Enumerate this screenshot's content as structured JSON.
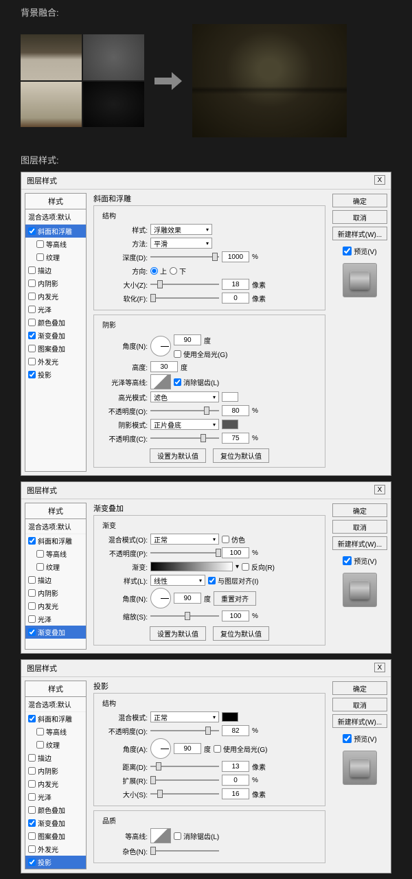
{
  "labels": {
    "bg_blend": "背景融合:",
    "layer_style": "图层样式:"
  },
  "dialog_title": "图层样式",
  "close_x": "X",
  "styles_header": "样式",
  "blend_options": "混合选项:默认",
  "style_items": {
    "bevel": "斜面和浮雕",
    "contour": "等高线",
    "texture": "纹理",
    "stroke": "描边",
    "inner_shadow": "内阴影",
    "inner_glow": "内发光",
    "satin": "光泽",
    "color_overlay": "颜色叠加",
    "gradient_overlay": "渐变叠加",
    "pattern_overlay": "图案叠加",
    "outer_glow": "外发光",
    "drop_shadow": "投影"
  },
  "buttons": {
    "ok": "确定",
    "cancel": "取消",
    "new_style": "新建样式(W)...",
    "preview": "预览(V)",
    "make_default": "设置为默认值",
    "reset_default": "复位为默认值",
    "reset_align": "重置对齐"
  },
  "bevel": {
    "title": "斜面和浮雕",
    "structure": "结构",
    "style_lbl": "样式:",
    "style_val": "浮雕效果",
    "technique_lbl": "方法:",
    "technique_val": "平滑",
    "depth_lbl": "深度(D):",
    "depth_val": "1000",
    "direction_lbl": "方向:",
    "dir_up": "上",
    "dir_down": "下",
    "size_lbl": "大小(Z):",
    "size_val": "18",
    "soften_lbl": "软化(F):",
    "soften_val": "0",
    "shading": "阴影",
    "angle_lbl": "角度(N):",
    "angle_val": "90",
    "use_global": "使用全局光(G)",
    "altitude_lbl": "高度:",
    "altitude_val": "30",
    "gloss_lbl": "光泽等高线:",
    "antialias": "消除锯齿(L)",
    "highlight_mode_lbl": "高光模式:",
    "highlight_mode_val": "滤色",
    "hl_opacity_lbl": "不透明度(O):",
    "hl_opacity_val": "80",
    "shadow_mode_lbl": "阴影模式:",
    "shadow_mode_val": "正片叠底",
    "sh_opacity_lbl": "不透明度(C):",
    "sh_opacity_val": "75",
    "px": "像素",
    "pct": "%",
    "deg": "度"
  },
  "gradient": {
    "title": "渐变叠加",
    "grad": "渐变",
    "blend_mode_lbl": "混合模式(O):",
    "blend_mode_val": "正常",
    "dither": "仿色",
    "opacity_lbl": "不透明度(P):",
    "opacity_val": "100",
    "gradient_lbl": "渐变:",
    "reverse": "反向(R)",
    "style_lbl": "样式(L):",
    "style_val": "线性",
    "align": "与图层对齐(I)",
    "angle_lbl": "角度(N):",
    "angle_val": "90",
    "scale_lbl": "缩放(S):",
    "scale_val": "100",
    "pct": "%",
    "deg": "度"
  },
  "shadow": {
    "title": "投影",
    "structure": "结构",
    "blend_mode_lbl": "混合模式:",
    "blend_mode_val": "正常",
    "opacity_lbl": "不透明度(O):",
    "opacity_val": "82",
    "angle_lbl": "角度(A):",
    "angle_val": "90",
    "use_global": "使用全局光(G)",
    "distance_lbl": "距离(D):",
    "distance_val": "13",
    "spread_lbl": "扩展(R):",
    "spread_val": "0",
    "size_lbl": "大小(S):",
    "size_val": "16",
    "quality": "品质",
    "contour_lbl": "等高线:",
    "antialias": "消除锯齿(L)",
    "noise_lbl": "杂色(N):",
    "px": "像素",
    "pct": "%",
    "deg": "度"
  }
}
